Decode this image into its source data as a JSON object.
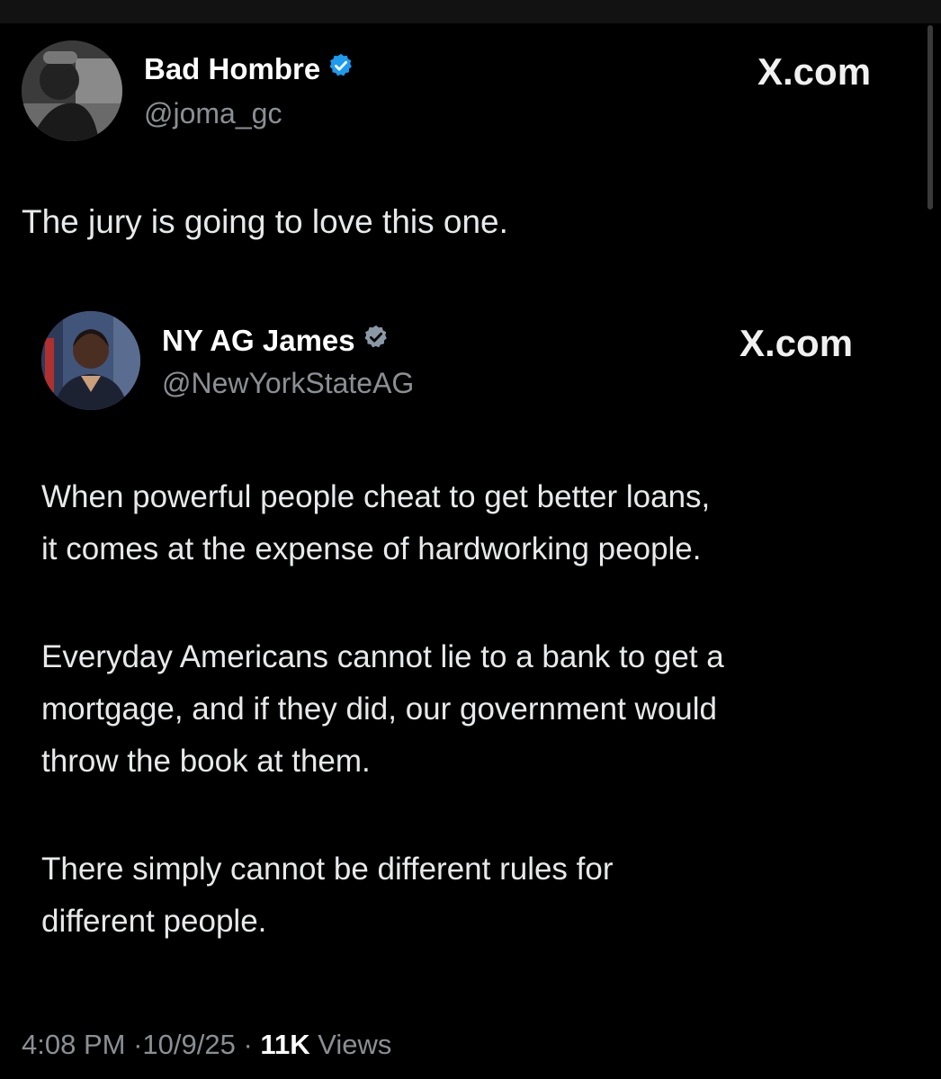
{
  "outer_tweet": {
    "author_name": "Bad Hombre",
    "handle": "@joma_gc",
    "brand": "X.com",
    "text": "The jury is going to love this one.",
    "badge_icon": "verified-badge-icon",
    "badge_color": "#1d9bf0"
  },
  "quoted_tweet": {
    "author_name": "NY AG James",
    "handle": "@NewYorkStateAG",
    "brand": "X.com",
    "badge_icon": "verified-badge-icon",
    "badge_color": "#8b98a5",
    "paragraphs": [
      {
        "line1": "When powerful people cheat to get better loans,",
        "line2": "it comes at the expense of hardworking people."
      },
      {
        "line1": "Everyday Americans cannot lie to a bank to get a",
        "line2": "mortgage, and if they did, our government would",
        "line3": "throw the book at them."
      },
      {
        "line1": "There simply cannot be different rules for",
        "line2": "different people."
      }
    ]
  },
  "meta": {
    "time": "4:08 PM",
    "date": "10/9/25",
    "views_count": "11K",
    "views_label": "Views",
    "separator": "·"
  }
}
